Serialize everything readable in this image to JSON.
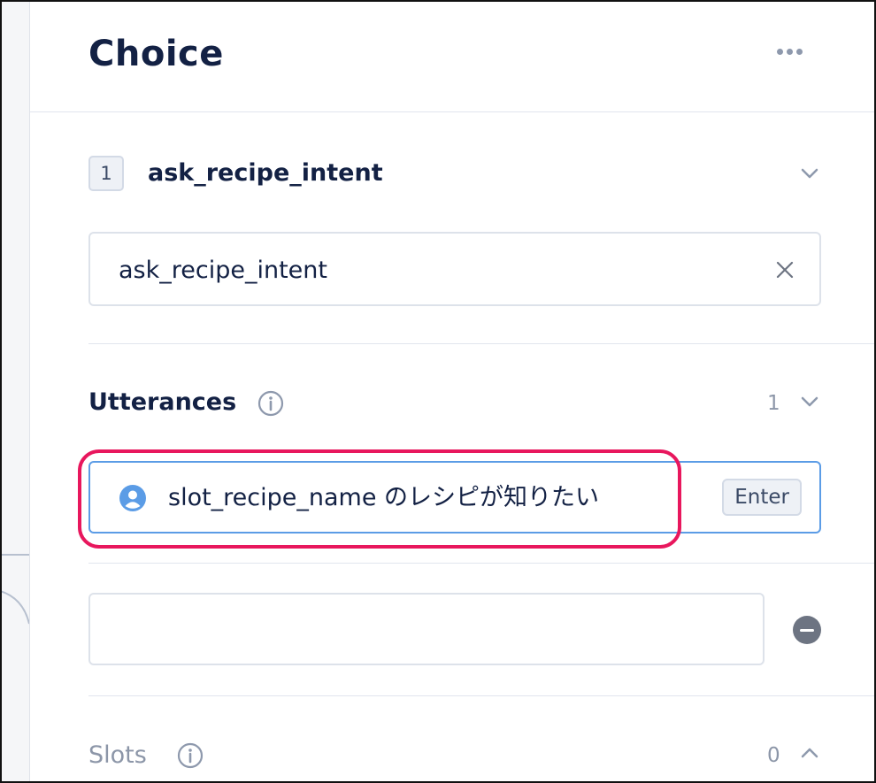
{
  "header": {
    "title": "Choice",
    "more_icon": "more-horizontal-icon"
  },
  "choice": {
    "index": "1",
    "name": "ask_recipe_intent",
    "intent_value": "ask_recipe_intent"
  },
  "utterances": {
    "title": "Utterances",
    "count": "1",
    "items": [
      {
        "text": "slot_recipe_name のレシピが知りたい",
        "enter_label": "Enter"
      },
      {
        "text": ""
      }
    ]
  },
  "slots": {
    "title": "Slots",
    "count": "0"
  },
  "colors": {
    "highlight": "#e8175d",
    "focus_border": "#5b9ce6",
    "title_text": "#132144",
    "muted_text": "#8c96a8"
  }
}
